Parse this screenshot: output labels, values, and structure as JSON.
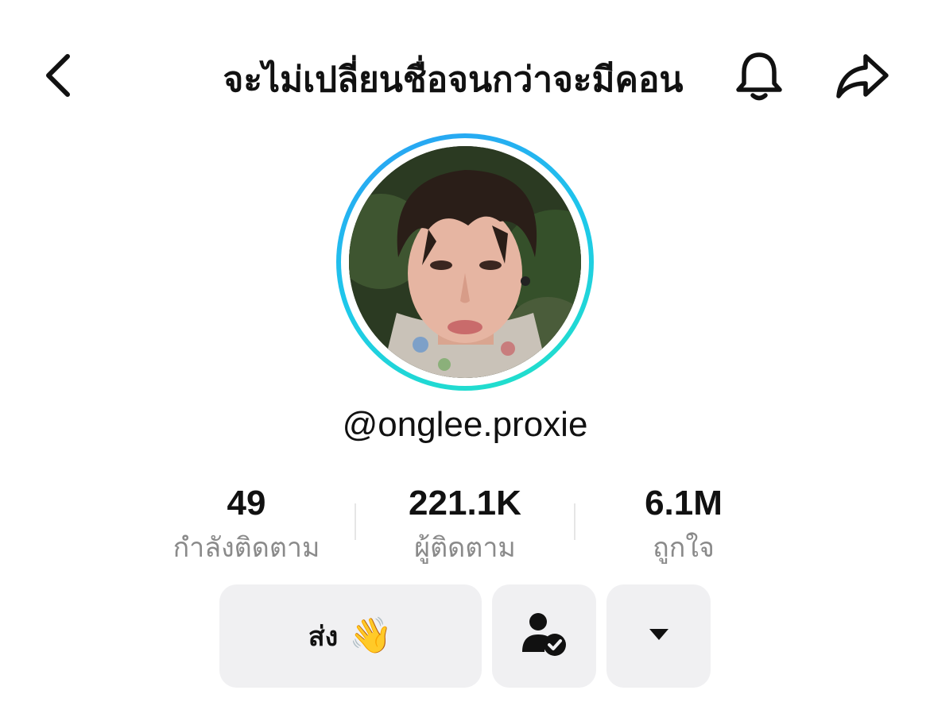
{
  "header": {
    "back_icon": "chevron-left-icon",
    "title": "จะไม่เปลี่ยนชื่อจนกว่าจะมีคอน",
    "bell_icon": "bell-icon",
    "share_icon": "share-arrow-icon"
  },
  "profile": {
    "username": "@onglee.proxie",
    "ring_colors": [
      "#2a9ff5",
      "#22e3c6"
    ]
  },
  "stats": {
    "following": {
      "value": "49",
      "label": "กำลังติดตาม"
    },
    "followers": {
      "value": "221.1K",
      "label": "ผู้ติดตาม"
    },
    "likes": {
      "value": "6.1M",
      "label": "ถูกใจ"
    }
  },
  "actions": {
    "send_label": "ส่ง",
    "send_emoji": "👋",
    "friend_icon": "person-check-icon",
    "more_icon": "caret-down-icon"
  },
  "colors": {
    "button_bg": "#f0f0f2",
    "label_gray": "#8a8a8a",
    "text": "#111111"
  }
}
